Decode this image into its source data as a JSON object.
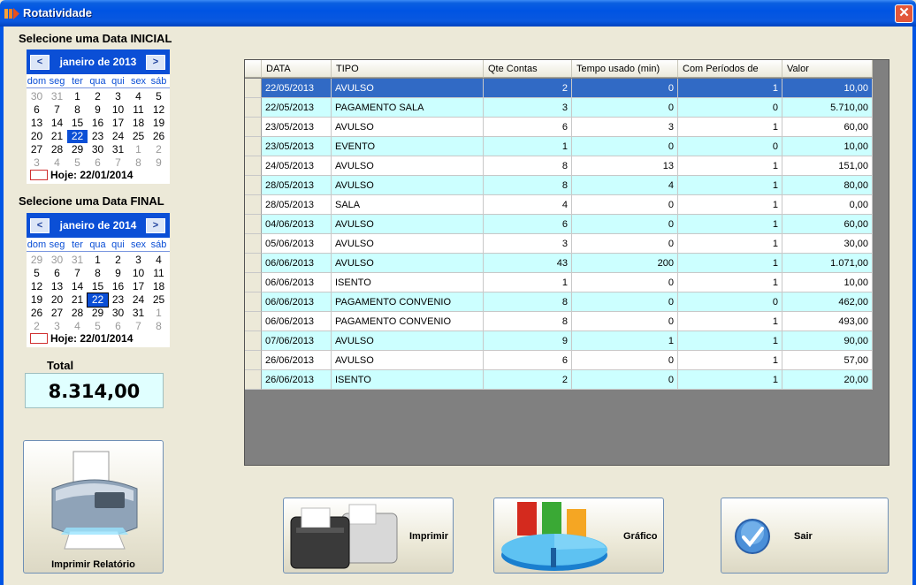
{
  "window": {
    "title": "Rotatividade",
    "close_glyph": "✕"
  },
  "start_calendar": {
    "heading": "Selecione uma Data INICIAL",
    "month": "janeiro de 2013",
    "prev": "<",
    "next": ">",
    "dow": [
      "dom",
      "seg",
      "ter",
      "qua",
      "qui",
      "sex",
      "sáb"
    ],
    "weeks": [
      [
        "30",
        "31",
        "1",
        "2",
        "3",
        "4",
        "5"
      ],
      [
        "6",
        "7",
        "8",
        "9",
        "10",
        "11",
        "12"
      ],
      [
        "13",
        "14",
        "15",
        "16",
        "17",
        "18",
        "19"
      ],
      [
        "20",
        "21",
        "22",
        "23",
        "24",
        "25",
        "26"
      ],
      [
        "27",
        "28",
        "29",
        "30",
        "31",
        "1",
        "2"
      ],
      [
        "3",
        "4",
        "5",
        "6",
        "7",
        "8",
        "9"
      ]
    ],
    "today": "Hoje: 22/01/2014"
  },
  "end_calendar": {
    "heading": "Selecione uma Data FINAL",
    "month": "janeiro de 2014",
    "prev": "<",
    "next": ">",
    "dow": [
      "dom",
      "seg",
      "ter",
      "qua",
      "qui",
      "sex",
      "sáb"
    ],
    "weeks": [
      [
        "29",
        "30",
        "31",
        "1",
        "2",
        "3",
        "4"
      ],
      [
        "5",
        "6",
        "7",
        "8",
        "9",
        "10",
        "11"
      ],
      [
        "12",
        "13",
        "14",
        "15",
        "16",
        "17",
        "18"
      ],
      [
        "19",
        "20",
        "21",
        "22",
        "23",
        "24",
        "25"
      ],
      [
        "26",
        "27",
        "28",
        "29",
        "30",
        "31",
        "1"
      ],
      [
        "2",
        "3",
        "4",
        "5",
        "6",
        "7",
        "8"
      ]
    ],
    "today": "Hoje: 22/01/2014"
  },
  "total": {
    "label": "Total",
    "value": "8.314,00"
  },
  "buttons": {
    "print_report": "Imprimir Relatório",
    "print": "Imprimir",
    "chart": "Gráfico",
    "exit": "Sair"
  },
  "table": {
    "columns": [
      "DATA",
      "TIPO",
      "Qte Contas",
      "Tempo usado (min)",
      "Com Períodos de",
      "Valor"
    ],
    "rows": [
      [
        "22/05/2013",
        "AVULSO",
        "2",
        "0",
        "1",
        "10,00"
      ],
      [
        "22/05/2013",
        "PAGAMENTO SALA",
        "3",
        "0",
        "0",
        "5.710,00"
      ],
      [
        "23/05/2013",
        "AVULSO",
        "6",
        "3",
        "1",
        "60,00"
      ],
      [
        "23/05/2013",
        "EVENTO",
        "1",
        "0",
        "0",
        "10,00"
      ],
      [
        "24/05/2013",
        "AVULSO",
        "8",
        "13",
        "1",
        "151,00"
      ],
      [
        "28/05/2013",
        "AVULSO",
        "8",
        "4",
        "1",
        "80,00"
      ],
      [
        "28/05/2013",
        "SALA",
        "4",
        "0",
        "1",
        "0,00"
      ],
      [
        "04/06/2013",
        "AVULSO",
        "6",
        "0",
        "1",
        "60,00"
      ],
      [
        "05/06/2013",
        "AVULSO",
        "3",
        "0",
        "1",
        "30,00"
      ],
      [
        "06/06/2013",
        "AVULSO",
        "43",
        "200",
        "1",
        "1.071,00"
      ],
      [
        "06/06/2013",
        "ISENTO",
        "1",
        "0",
        "1",
        "10,00"
      ],
      [
        "06/06/2013",
        "PAGAMENTO CONVENIO",
        "8",
        "0",
        "0",
        "462,00"
      ],
      [
        "06/06/2013",
        "PAGAMENTO CONVENIO",
        "8",
        "0",
        "1",
        "493,00"
      ],
      [
        "07/06/2013",
        "AVULSO",
        "9",
        "1",
        "1",
        "90,00"
      ],
      [
        "26/06/2013",
        "AVULSO",
        "6",
        "0",
        "1",
        "57,00"
      ],
      [
        "26/06/2013",
        "ISENTO",
        "2",
        "0",
        "1",
        "20,00"
      ]
    ],
    "selected_row": 0
  },
  "colors": {
    "accent": "#0b4fd6",
    "row_alt": "#ccffff",
    "selection": "#316ac5"
  }
}
